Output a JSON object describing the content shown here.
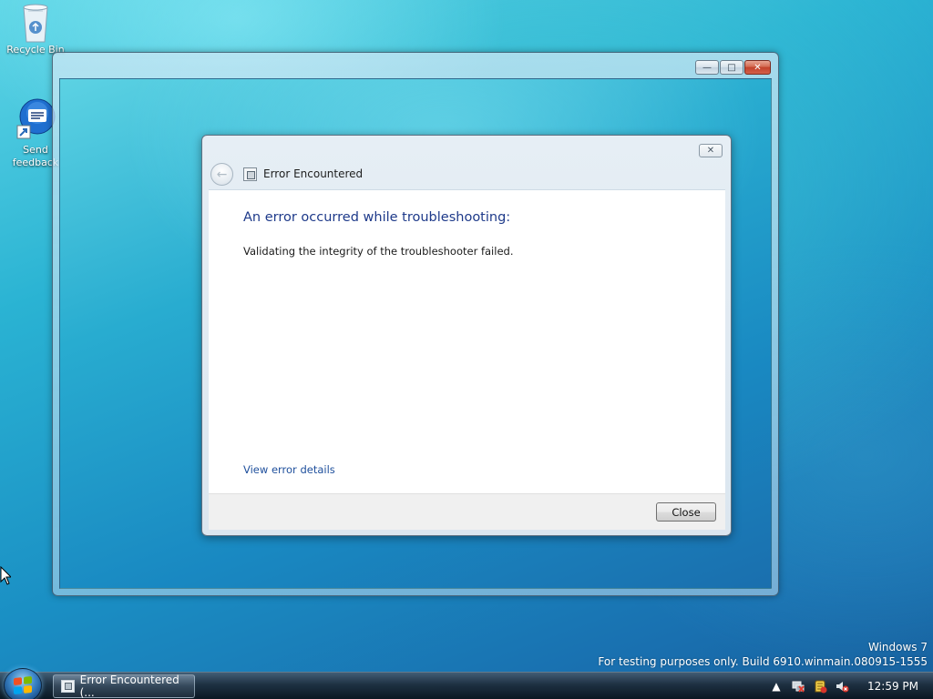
{
  "desktop": {
    "icons": [
      {
        "label": "Recycle Bin",
        "icon": "recycle-bin-icon"
      },
      {
        "label": "Send feedback",
        "icon": "send-feedback-icon"
      }
    ]
  },
  "outer_window": {
    "controls": {
      "minimize": "minimize",
      "maximize": "maximize",
      "close": "close"
    }
  },
  "dialog": {
    "title": "Error Encountered",
    "heading": "An error occurred while troubleshooting:",
    "message": "Validating the integrity of the troubleshooter failed.",
    "details_link": "View error details",
    "close_button": "Close",
    "heading_color": "#1e3a8a",
    "link_color": "#1e4f9c"
  },
  "watermark": {
    "line1": "Windows 7",
    "line2": "For testing purposes only. Build 6910.winmain.080915-1555"
  },
  "taskbar": {
    "task_button_label": "Error Encountered (...",
    "clock": "12:59 PM",
    "tray_icons": [
      "show-hidden-icons-arrow",
      "network-icon",
      "action-center-icon",
      "volume-muted-icon"
    ]
  }
}
